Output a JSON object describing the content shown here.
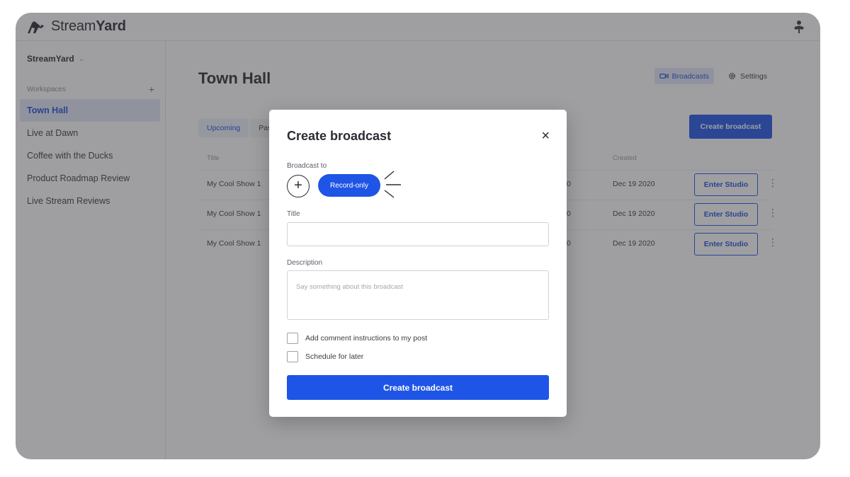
{
  "brand": {
    "name_light": "Stream",
    "name_bold": "Yard"
  },
  "sidebar": {
    "org": "StreamYard",
    "workspaces_label": "Workspaces",
    "add_symbol": "+",
    "items": [
      {
        "label": "Town Hall",
        "active": true
      },
      {
        "label": "Live at Dawn"
      },
      {
        "label": "Coffee with the Ducks"
      },
      {
        "label": "Product Roadmap Review"
      },
      {
        "label": "Live Stream Reviews"
      }
    ]
  },
  "header": {
    "title": "Town Hall",
    "nav": [
      {
        "label": "Broadcasts",
        "icon": "video-camera-icon",
        "active": true
      },
      {
        "label": "Settings",
        "icon": "gear-icon"
      }
    ]
  },
  "tabs": [
    {
      "label": "Upcoming",
      "active": true
    },
    {
      "label": "Past"
    }
  ],
  "create_button": "Create broadcast",
  "table": {
    "columns": [
      "Title",
      "Created"
    ],
    "rows": [
      {
        "title": "My Cool Show 1",
        "col_fragment": "0",
        "created": "Dec 19 2020",
        "action": "Enter Studio"
      },
      {
        "title": "My Cool Show 1",
        "col_fragment": "0",
        "created": "Dec 19 2020",
        "action": "Enter Studio"
      },
      {
        "title": "My Cool Show 1",
        "col_fragment": "0",
        "created": "Dec 19 2020",
        "action": "Enter Studio"
      }
    ]
  },
  "modal": {
    "title": "Create broadcast",
    "close_symbol": "×",
    "broadcast_to_label": "Broadcast to",
    "add_symbol": "+",
    "record_only_label": "Record-only",
    "title_label": "Title",
    "title_value": "",
    "description_label": "Description",
    "description_placeholder": "Say something about this broadcast",
    "checkbox_comments": "Add comment instructions to my post",
    "checkbox_schedule": "Schedule for later",
    "submit": "Create broadcast"
  },
  "colors": {
    "accent": "#1f55e6",
    "overlay": "rgba(55,55,60,0.48)"
  }
}
